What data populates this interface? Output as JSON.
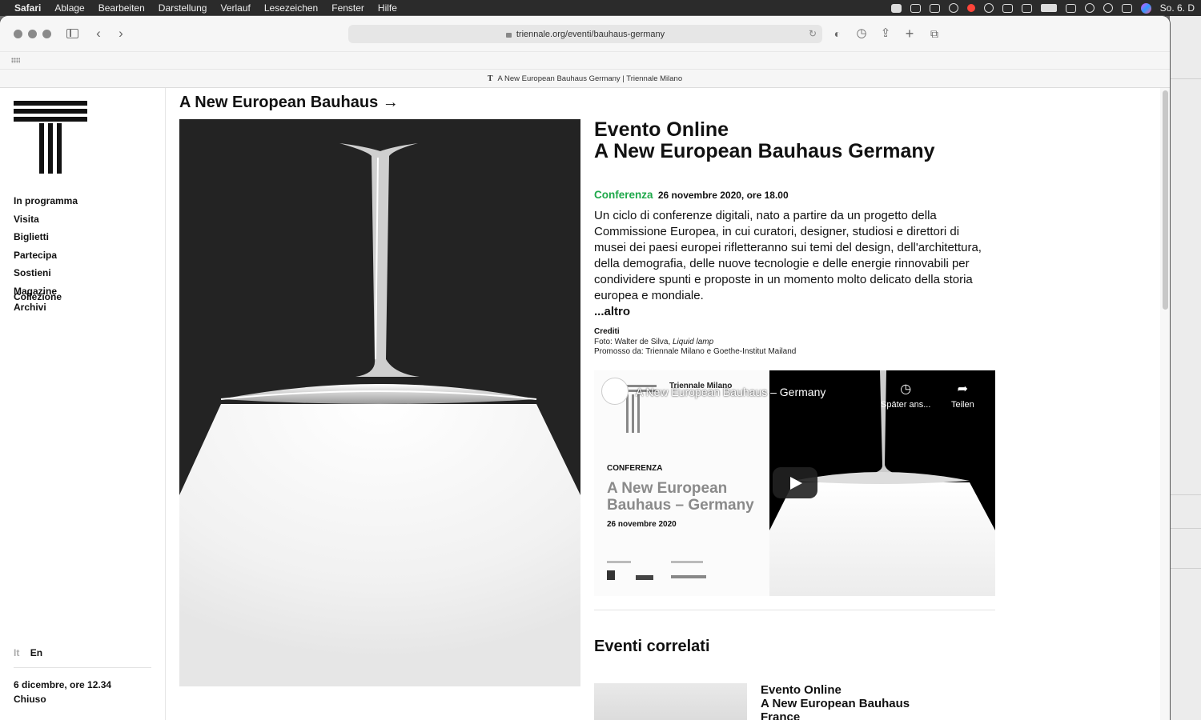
{
  "menubar": {
    "app": "Safari",
    "items": [
      "Ablage",
      "Bearbeiten",
      "Darstellung",
      "Verlauf",
      "Lesezeichen",
      "Fenster",
      "Hilfe"
    ],
    "clock": "So. 6. D"
  },
  "browser": {
    "url": "triennale.org/eventi/bauhaus-germany",
    "tab_title": "A New European Bauhaus Germany  | Triennale Milano",
    "tab_favicon": "T"
  },
  "sidebar": {
    "nav": [
      {
        "label": "In programma"
      },
      {
        "label": "Visita"
      },
      {
        "label": "Biglietti"
      },
      {
        "label": "Partecipa"
      },
      {
        "label": "Sostieni"
      },
      {
        "label": "Magazine"
      }
    ],
    "nav_clipped": [
      "Collezione",
      "Archivi"
    ],
    "lang_it": "It",
    "lang_en": "En",
    "date": "6 dicembre, ore 12.34",
    "status": "Chiuso"
  },
  "page": {
    "kicker": "A New European Bauhaus →",
    "event_kind": "Evento Online",
    "event_title": "A New European Bauhaus Germany",
    "category": "Conferenza",
    "datetime": "26 novembre 2020, ore 18.00",
    "description": "Un ciclo di conferenze digitali, nato a partire da un progetto della Commissione Europea, in cui curatori, designer, studiosi e direttori di musei dei paesi europei rifletteranno sui temi del design, dell'architettura, della demografia, delle nuove tecnologie e delle energie rinnovabili per condividere spunti e proposte in un momento molto delicato della storia europea e mondiale.",
    "more": "...altro",
    "credits_title": "Crediti",
    "credits_photo_prefix": "Foto: Walter de Silva, ",
    "credits_photo_work": "Liquid lamp",
    "credits_promoter": "Promosso da: Triennale Milano e Goethe-Institut Mailand"
  },
  "video": {
    "title": "A New European Bauhaus – Germany",
    "channel": "Triennale Milano",
    "watch_later": "Später ans...",
    "share": "Teilen",
    "thumb_label": "CONFERENZA",
    "thumb_title": "A New European Bauhaus – Germany",
    "thumb_date": "26 novembre 2020"
  },
  "related": {
    "heading": "Eventi correlati",
    "items": [
      {
        "kind": "Evento Online",
        "title": "A New European Bauhaus",
        "country": "France"
      }
    ]
  },
  "colors": {
    "accent_green": "#1ea84a",
    "text": "#111111"
  }
}
